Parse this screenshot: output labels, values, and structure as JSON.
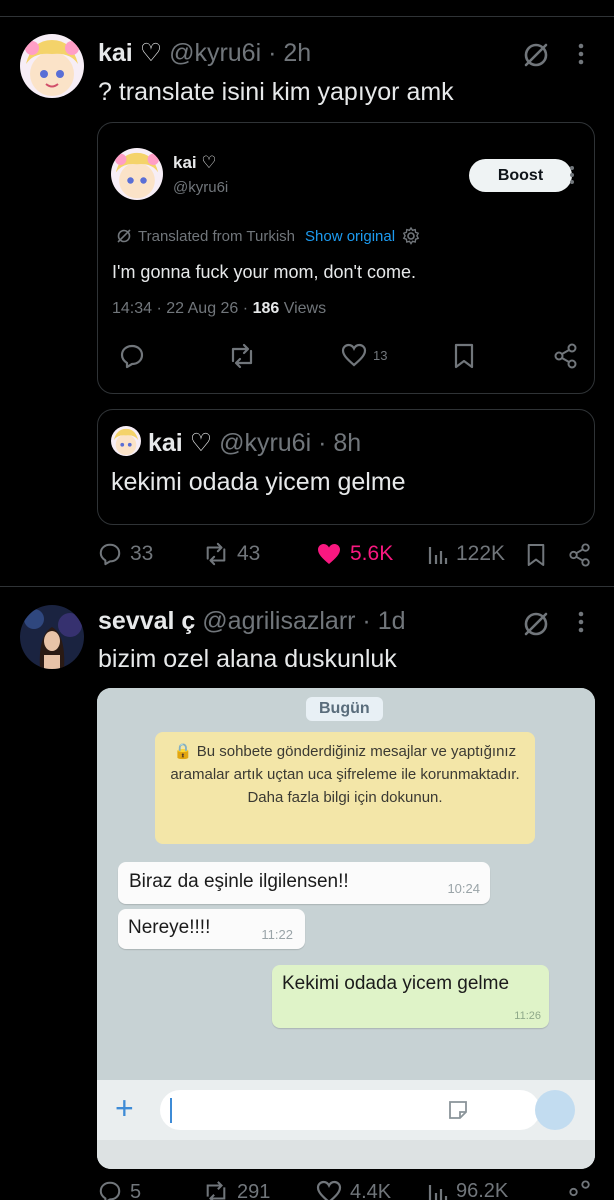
{
  "tweet1": {
    "author_name": "kai ♡",
    "handle": "@kyru6i",
    "separator": "·",
    "time": "2h",
    "text": "? translate isini kim yapıyor amk",
    "quote": {
      "author_name": "kai ♡",
      "handle": "@kyru6i",
      "boost_label": "Boost",
      "translated_label": "Translated from Turkish",
      "show_original_label": "Show original",
      "body": "I'm gonna fuck your mom, don't come.",
      "date": "14:34 · 22 Aug 26 ·",
      "views_count": "186",
      "views_label": "Views",
      "like_count": "13"
    },
    "quote2": {
      "author_name": "kai ♡",
      "handle": "@kyru6i",
      "separator": "·",
      "time": "8h",
      "text": "kekimi odada yicem gelme"
    },
    "actions": {
      "replies": "33",
      "reposts": "43",
      "likes": "5.6K",
      "views": "122K"
    }
  },
  "tweet2": {
    "author_name": "sevval ç",
    "handle": "@agrilisazlarr",
    "separator": "·",
    "time": "1d",
    "text": "bizim ozel alana duskunluk",
    "media": {
      "chip_today": "Bugün",
      "notice": "🔒 Bu sohbete gönderdiğiniz mesajlar ve yaptığınız aramalar artık uçtan uca şifreleme ile korunmaktadır. Daha fazla bilgi için dokunun.",
      "messages": [
        {
          "text": "Biraz da eşinle ilgilensen!!",
          "time": "10:24"
        },
        {
          "text": "Nereye!!!!",
          "time": "11:22"
        },
        {
          "text": "Kekimi odada yicem gelme",
          "time": "11:26"
        }
      ],
      "input_plus": "+"
    },
    "actions": {
      "replies": "5",
      "reposts": "291",
      "likes": "4.4K",
      "views": "96.2K"
    }
  },
  "colors": {
    "background": "#000000",
    "text": "#e7e9ea",
    "muted": "#71767b",
    "link": "#1d9bf0",
    "like": "#f91880",
    "border": "#2f3336"
  }
}
